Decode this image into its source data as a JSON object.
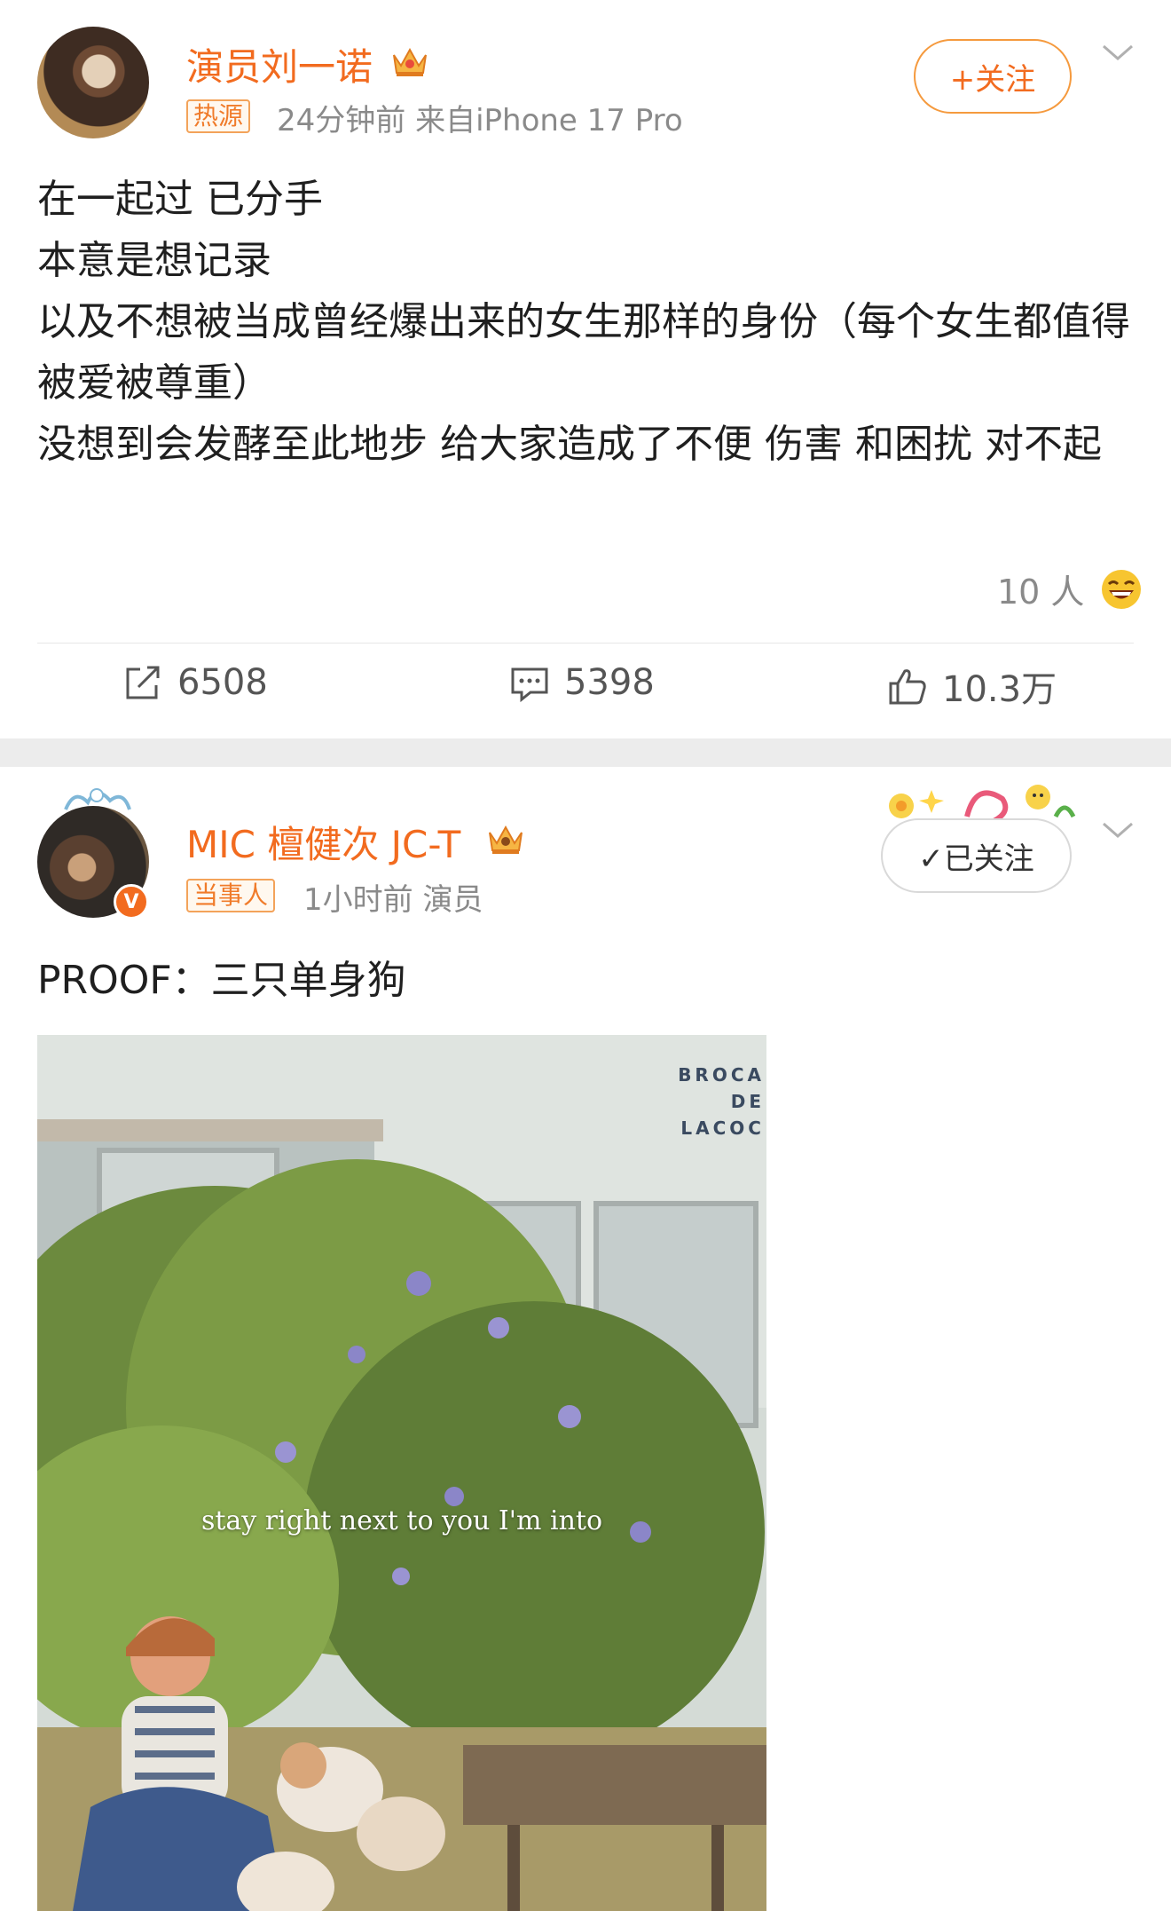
{
  "post1": {
    "author": "演员刘一诺",
    "tag": "热源",
    "time_source": "24分钟前  来自iPhone 17 Pro",
    "follow_label": "+关注",
    "content": [
      "在一起过 已分手",
      "本意是想记录",
      "以及不想被当成曾经爆出来的女生那样的身份（每个女生都值得被爱被尊重）",
      "没想到会发酵至此地步 给大家造成了不便 伤害 和困扰 对不起"
    ],
    "reaction_count": "10 人",
    "shares": "6508",
    "comments": "5398",
    "likes": "10.3万"
  },
  "post2": {
    "author": "MIC 檀健次 JC-T",
    "tag": "当事人",
    "time_source": "1小时前  演员",
    "followed_label": "✓已关注",
    "verified_badge": "V",
    "content": "PROOF：三只单身狗",
    "image_caption": "stay right next to you I'm into",
    "image_sign": "BROCA\nDE\nLACOC"
  },
  "colors": {
    "accent": "#f26b1f",
    "meta": "#8a8a8a",
    "separator": "#ececec"
  }
}
